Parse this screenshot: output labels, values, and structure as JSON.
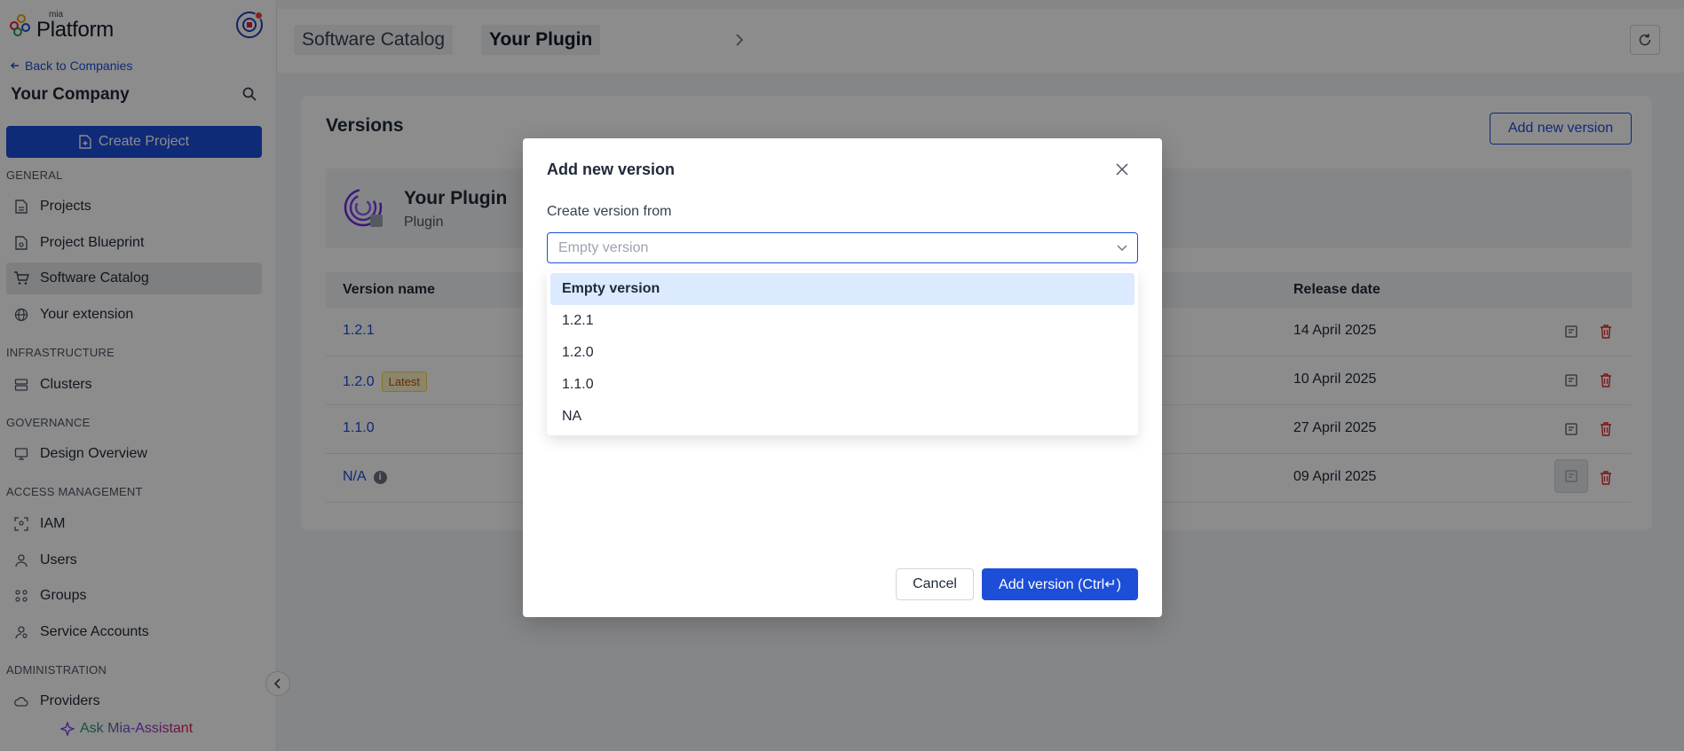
{
  "sidebar": {
    "logo_small": "mia",
    "logo_big": "Platform",
    "back_link": "Back to Companies",
    "company": "Your Company",
    "create_project": "Create Project",
    "sections": {
      "general": "GENERAL",
      "infrastructure": "INFRASTRUCTURE",
      "governance": "GOVERNANCE",
      "access": "ACCESS MANAGEMENT",
      "administration": "ADMINISTRATION"
    },
    "items": {
      "projects": "Projects",
      "blueprint": "Project Blueprint",
      "catalog": "Software Catalog",
      "extension": "Your extension",
      "clusters": "Clusters",
      "design": "Design Overview",
      "iam": "IAM",
      "users": "Users",
      "groups": "Groups",
      "service_accounts": "Service Accounts",
      "providers": "Providers"
    },
    "assistant": "Ask Mia-Assistant"
  },
  "header": {
    "breadcrumb_1": "Software Catalog",
    "breadcrumb_2": "Your Plugin"
  },
  "main": {
    "title": "Versions",
    "add_button": "Add new version",
    "plugin_name": "Your Plugin",
    "plugin_type": "Plugin",
    "columns": {
      "name": "Version name",
      "date": "Release date"
    },
    "rows": [
      {
        "version": "1.2.1",
        "badge": "",
        "date": "14 April 2025"
      },
      {
        "version": "1.2.0",
        "badge": "Latest",
        "date": "10 April 2025"
      },
      {
        "version": "1.1.0",
        "badge": "",
        "date": "27 April 2025"
      },
      {
        "version": "N/A",
        "badge": "",
        "date": "09 April 2025"
      }
    ]
  },
  "modal": {
    "title": "Add new version",
    "field_label": "Create version from",
    "select_placeholder": "Empty version",
    "options": [
      "Empty version",
      "1.2.1",
      "1.2.0",
      "1.1.0",
      "NA"
    ],
    "cancel": "Cancel",
    "submit": "Add version (Ctrl↵)"
  },
  "colors": {
    "primary": "#1d4ed8",
    "danger": "#dc2626",
    "badge": "#b45309"
  }
}
